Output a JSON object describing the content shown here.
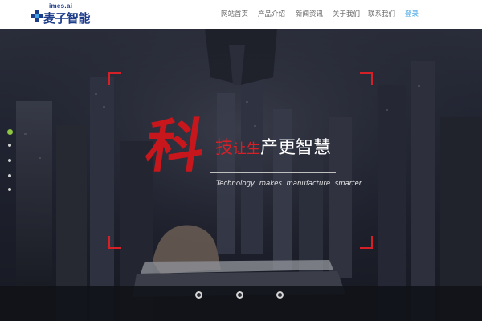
{
  "brand": {
    "domain": "imes.ai",
    "name": "麦子智能",
    "colors": {
      "primary": "#1d3c8a",
      "accent": "#3ea2e6",
      "red": "#d42026",
      "green": "#8ec63f"
    }
  },
  "nav": {
    "items": [
      {
        "label": "网站首页",
        "active": false
      },
      {
        "label": "产品介绍",
        "active": false
      },
      {
        "label": "新闻资讯",
        "active": false
      },
      {
        "label": "关于我们",
        "active": false
      },
      {
        "label": "联系我们",
        "active": false
      },
      {
        "label": "登录",
        "active": true
      }
    ]
  },
  "hero": {
    "big_char": "科",
    "headline_ji": "技",
    "headline_rangsheng": "让生",
    "headline_rest": "产更智慧",
    "subline": "Technology makes manufacture smarter",
    "slide_dots": 5,
    "active_slide": 1,
    "timeline_nodes": 3
  },
  "icons": {
    "logo_mark": "plus-cross-icon"
  }
}
